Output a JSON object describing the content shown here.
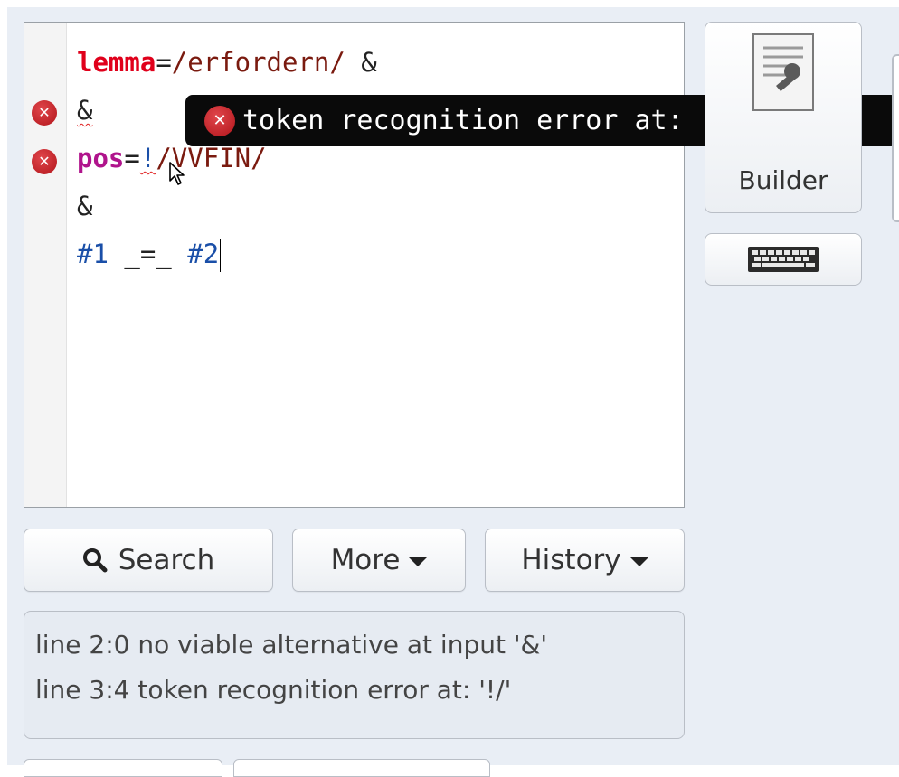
{
  "editor": {
    "lines": [
      {
        "parts": [
          {
            "t": "lemma",
            "c": "kw-lemma"
          },
          {
            "t": "=",
            "c": ""
          },
          {
            "t": "/erfordern/",
            "c": "regex"
          },
          {
            "t": " &",
            "c": ""
          }
        ]
      },
      {
        "parts": [
          {
            "t": "&",
            "c": "squiggle"
          }
        ]
      },
      {
        "parts": [
          {
            "t": "pos",
            "c": "kw-pos"
          },
          {
            "t": "=",
            "c": ""
          },
          {
            "t": "!",
            "c": "squiggle ref"
          },
          {
            "t": "/VVFIN/",
            "c": "regex"
          }
        ]
      },
      {
        "parts": [
          {
            "t": "&",
            "c": ""
          }
        ]
      },
      {
        "parts": [
          {
            "t": "#1",
            "c": "ref"
          },
          {
            "t": " _=_ ",
            "c": ""
          },
          {
            "t": "#2",
            "c": "ref"
          }
        ]
      }
    ],
    "error_marker_lines": [
      2,
      3
    ]
  },
  "tooltip": {
    "text": "token recognition error at: '!/'"
  },
  "buttons": {
    "search": "Search",
    "more": "More",
    "history": "History"
  },
  "side": {
    "builder_label": "Builder",
    "builder_hidden_fragment": "(...)"
  },
  "messages": [
    "line 2:0 no viable alternative at input '&'",
    "line 3:4 token recognition error at: '!/'"
  ],
  "icons": {
    "error": "error-circle-icon",
    "search": "magnifier-icon",
    "dropdown": "caret-down-icon",
    "keyboard": "keyboard-icon",
    "builder": "query-builder-document-icon"
  }
}
